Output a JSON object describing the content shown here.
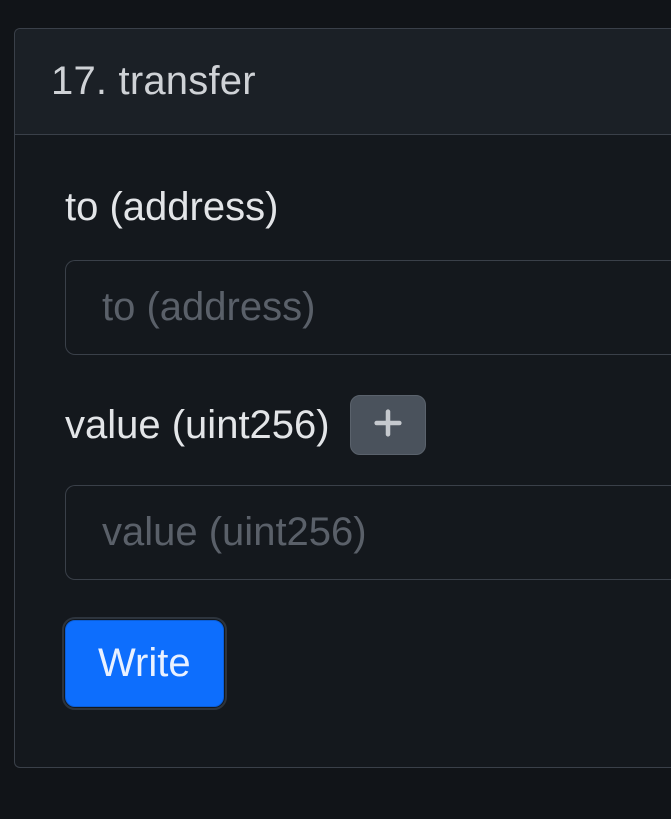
{
  "function": {
    "index": "17",
    "name": "transfer",
    "title": "17. transfer"
  },
  "fields": {
    "to": {
      "label": "to (address)",
      "placeholder": "to (address)",
      "value": ""
    },
    "value": {
      "label": "value (uint256)",
      "placeholder": "value (uint256)",
      "value": ""
    }
  },
  "actions": {
    "write_label": "Write"
  }
}
